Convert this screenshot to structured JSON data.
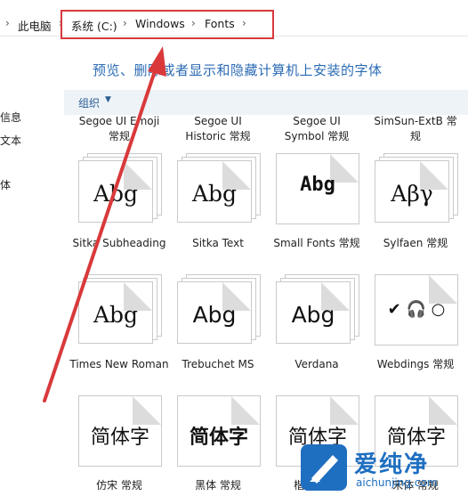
{
  "breadcrumb": {
    "items": [
      "此电脑",
      "系统 (C:)",
      "Windows",
      "Fonts"
    ],
    "separator": ">"
  },
  "left_nav": {
    "fragments": [
      "信息",
      "文本",
      "体"
    ]
  },
  "heading": "预览、删除或者显示和隐藏计算机上安装的字体",
  "toolbar": {
    "organize_label": "组织",
    "caret": "▼"
  },
  "top_row_labels": [
    [
      "Segoe UI Emoji",
      "常规"
    ],
    [
      "Segoe UI",
      "Historic 常规"
    ],
    [
      "Segoe UI",
      "Symbol 常规"
    ],
    [
      "SimSun-ExtB 常",
      "规"
    ]
  ],
  "fonts": [
    {
      "name": "Sitka Subheading",
      "sample": "Abg",
      "style": "serif"
    },
    {
      "name": "Sitka Text",
      "sample": "Abg",
      "style": "serif"
    },
    {
      "name": "Small Fonts 常规",
      "sample": "Abg",
      "style": "pixel"
    },
    {
      "name": "Sylfaen 常规",
      "sample": "Αβγ",
      "style": "serif"
    },
    {
      "name": "Times New Roman",
      "sample": "Abg",
      "style": "serif"
    },
    {
      "name": "Trebuchet MS",
      "sample": "Abg",
      "style": "sans"
    },
    {
      "name": "Verdana",
      "sample": "Abg",
      "style": "sans"
    },
    {
      "name": "Webdings 常规",
      "sample": "✔ 🎧 ○",
      "style": "symbol"
    },
    {
      "name": "仿宋 常规",
      "sample": "简体字",
      "style": "cjk"
    },
    {
      "name": "黑体 常规",
      "sample": "简体字",
      "style": "cjk-bold"
    },
    {
      "name": "楷体 常规",
      "sample": "简体字",
      "style": "cjk"
    },
    {
      "name": "宋体 常规",
      "sample": "简体字",
      "style": "cjk"
    }
  ],
  "watermark": {
    "brand": "爱纯净",
    "url": "aichunjing.com"
  },
  "colors": {
    "annotation": "#d9393b",
    "heading": "#2b6bb5",
    "watermark": "#1f6fc0"
  }
}
